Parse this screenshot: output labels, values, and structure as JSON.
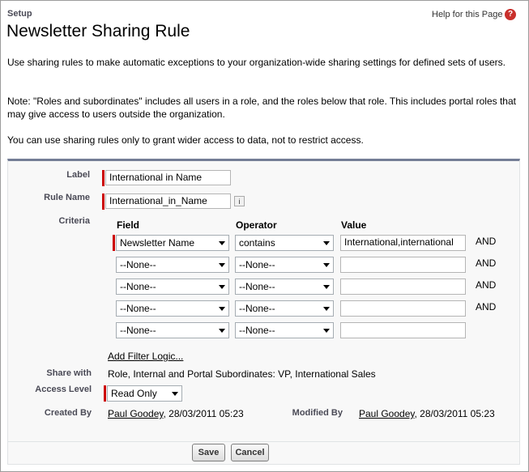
{
  "header": {
    "section": "Setup",
    "title": "Newsletter Sharing Rule",
    "help_link": "Help for this Page",
    "help_icon": "?"
  },
  "description": {
    "p1": "Use sharing rules to make automatic exceptions to your organization-wide sharing settings for defined sets of users.",
    "p2": "Note: \"Roles and subordinates\" includes all users in a role, and the roles below that role. This includes portal roles that may give access to users outside the organization.",
    "p3": "You can use sharing rules only to grant wider access to data, not to restrict access."
  },
  "form": {
    "label_label": "Label",
    "label_value": "International in Name",
    "rule_name_label": "Rule Name",
    "rule_name_value": "International_in_Name",
    "info_icon": "i",
    "criteria_label": "Criteria",
    "criteria_headers": {
      "field": "Field",
      "operator": "Operator",
      "value": "Value"
    },
    "criteria_rows": [
      {
        "field": "Newsletter Name",
        "operator": "contains",
        "value": "International,international",
        "conjunction": "AND"
      },
      {
        "field": "--None--",
        "operator": "--None--",
        "value": "",
        "conjunction": "AND"
      },
      {
        "field": "--None--",
        "operator": "--None--",
        "value": "",
        "conjunction": "AND"
      },
      {
        "field": "--None--",
        "operator": "--None--",
        "value": "",
        "conjunction": "AND"
      },
      {
        "field": "--None--",
        "operator": "--None--",
        "value": "",
        "conjunction": ""
      }
    ],
    "add_filter_logic": "Add Filter Logic...",
    "share_with_label": "Share with",
    "share_with_value": "Role, Internal and Portal Subordinates: VP, International Sales",
    "access_level_label": "Access Level",
    "access_level_value": "Read Only",
    "created_by_label": "Created By",
    "created_by_user": "Paul Goodey",
    "created_by_date": ", 28/03/2011 05:23",
    "modified_by_label": "Modified By",
    "modified_by_user": "Paul Goodey",
    "modified_by_date": ", 28/03/2011 05:23"
  },
  "buttons": {
    "save": "Save",
    "cancel": "Cancel"
  },
  "colors": {
    "required": "#cc0000",
    "panel_border": "#747e96",
    "help_icon": "#c9302c"
  }
}
